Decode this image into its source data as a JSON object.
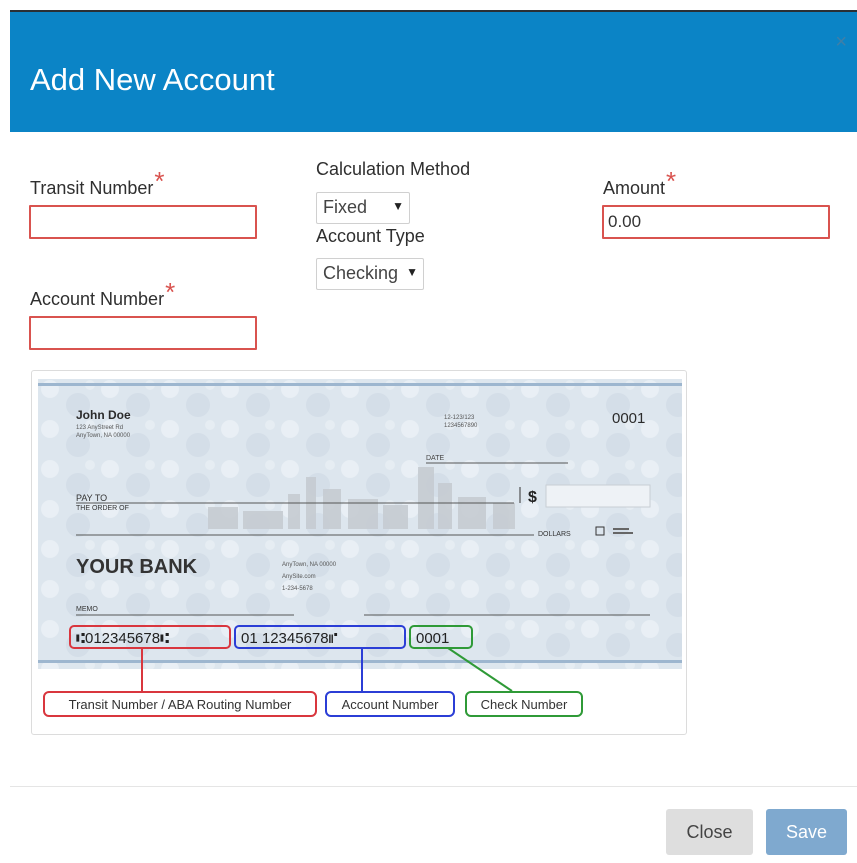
{
  "dialog": {
    "title": "Add New Account",
    "close_icon": "×"
  },
  "form": {
    "transit_label": "Transit Number",
    "required_marker": "*",
    "transit_value": "",
    "account_label": "Account Number",
    "account_value": "",
    "calc_method_label": "Calculation Method",
    "calc_method_value": "Fixed",
    "account_type_label": "Account Type",
    "account_type_value": "Checking",
    "amount_label": "Amount",
    "amount_value": "0.00"
  },
  "check": {
    "name": "John Doe",
    "address1": "123 AnyStreet Rd",
    "address2": "AnyTown, NA 00000",
    "fraction1": "12-123/123",
    "fraction2": "1234567890",
    "check_no": "0001",
    "date_label": "DATE",
    "pay_to_1": "PAY TO",
    "pay_to_2": "THE ORDER OF",
    "dollar_sign": "$",
    "dollars_label": "DOLLARS",
    "bank_name": "YOUR BANK",
    "bank_addr1": "AnyTown, NA 00000",
    "bank_addr2": "AnySite.com",
    "bank_addr3": "1-234-5678",
    "memo_label": "MEMO",
    "micr_routing": "⑆012345678⑆",
    "micr_account": "01 12345678⑈",
    "micr_check": "0001",
    "callout_routing": "Transit Number / ABA Routing Number",
    "callout_account": "Account Number",
    "callout_check": "Check Number",
    "colors": {
      "routing": "#d9363e",
      "account": "#2b3ed6",
      "check": "#2f9a37"
    }
  },
  "footer": {
    "close_label": "Close",
    "save_label": "Save"
  }
}
